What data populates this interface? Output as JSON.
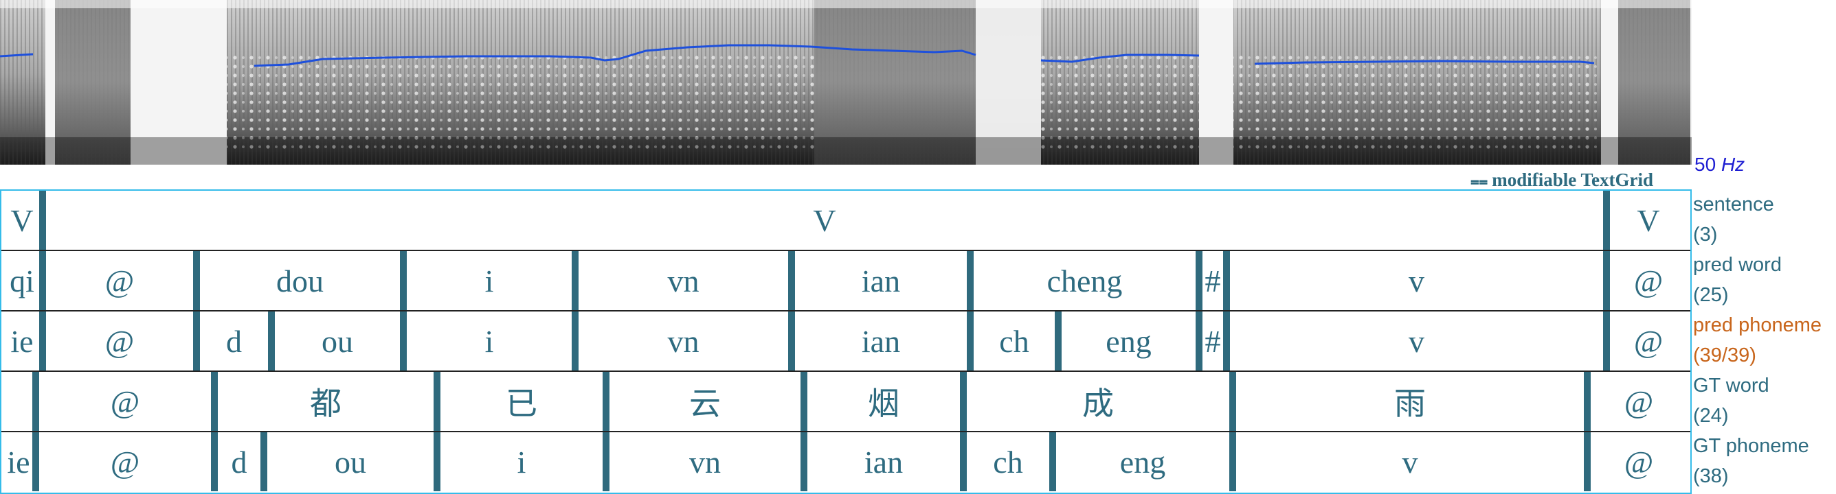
{
  "pitch": {
    "value": "50",
    "unit": "Hz"
  },
  "textgrid": {
    "label": "modifiable TextGrid",
    "icon": "textgrid-icon"
  },
  "colors": {
    "tier_text": "#2e6b80",
    "boundary": "#2f6a7d",
    "active_tier": "#c8651b",
    "selection_border": "#35bcea",
    "pitch": "#1e50dc"
  },
  "tiers": [
    {
      "name": "sentence",
      "count": "(3)",
      "intervals": [
        "V",
        "V",
        "V"
      ]
    },
    {
      "name": "pred word",
      "count": "(25)",
      "intervals": [
        "qi",
        "@",
        "dou",
        "i",
        "vn",
        "ian",
        "cheng",
        "#",
        "v",
        "@"
      ]
    },
    {
      "name": "pred phoneme",
      "count": "(39/39)",
      "active": true,
      "intervals": [
        "ie",
        "@",
        "d",
        "ou",
        "i",
        "vn",
        "ian",
        "ch",
        "eng",
        "#",
        "v",
        "@"
      ]
    },
    {
      "name": "GT word",
      "count": "(24)",
      "intervals": [
        "",
        "@",
        "都",
        "已",
        "云",
        "烟",
        "成",
        "雨",
        "@"
      ]
    },
    {
      "name": "GT phoneme",
      "count": "(38)",
      "intervals": [
        "ie",
        "@",
        "d",
        "ou",
        "i",
        "vn",
        "ian",
        "ch",
        "eng",
        "v",
        "@"
      ]
    }
  ]
}
